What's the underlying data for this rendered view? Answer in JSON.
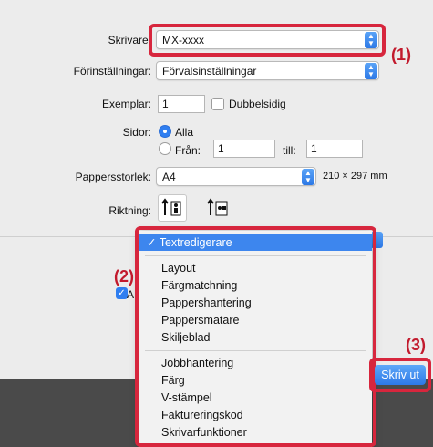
{
  "dialog": {
    "printer_label": "Skrivare:",
    "printer_value": "MX-xxxx",
    "presets_label": "Förinställningar:",
    "presets_value": "Förvalsinställningar",
    "copies_label": "Exemplar:",
    "copies_value": "1",
    "duplex_label": "Dubbelsidig",
    "pages_label": "Sidor:",
    "pages_all": "Alla",
    "pages_from": "Från:",
    "pages_from_value": "1",
    "pages_to": "till:",
    "pages_to_value": "1",
    "paper_label": "Pappersstorlek:",
    "paper_value": "A4",
    "paper_dims": "210 × 297 mm",
    "orientation_label": "Riktning:",
    "print_button": "Skriv ut"
  },
  "menu": {
    "selected": "✓ Textredigerare",
    "items_group1": [
      "Layout",
      "Färgmatchning",
      "Pappershantering",
      "Pappersmatare",
      "Skiljeblad"
    ],
    "items_group2": [
      "Jobbhantering",
      "Färg",
      "V-stämpel",
      "Faktureringskod",
      "Skrivarfunktioner"
    ]
  },
  "callouts": {
    "c1": "(1)",
    "c2": "(2)",
    "c3": "(3)"
  },
  "colors": {
    "highlight_red": "#d7263d",
    "accent_blue": "#2f7ef0",
    "callout_text": "#c21a2d"
  }
}
